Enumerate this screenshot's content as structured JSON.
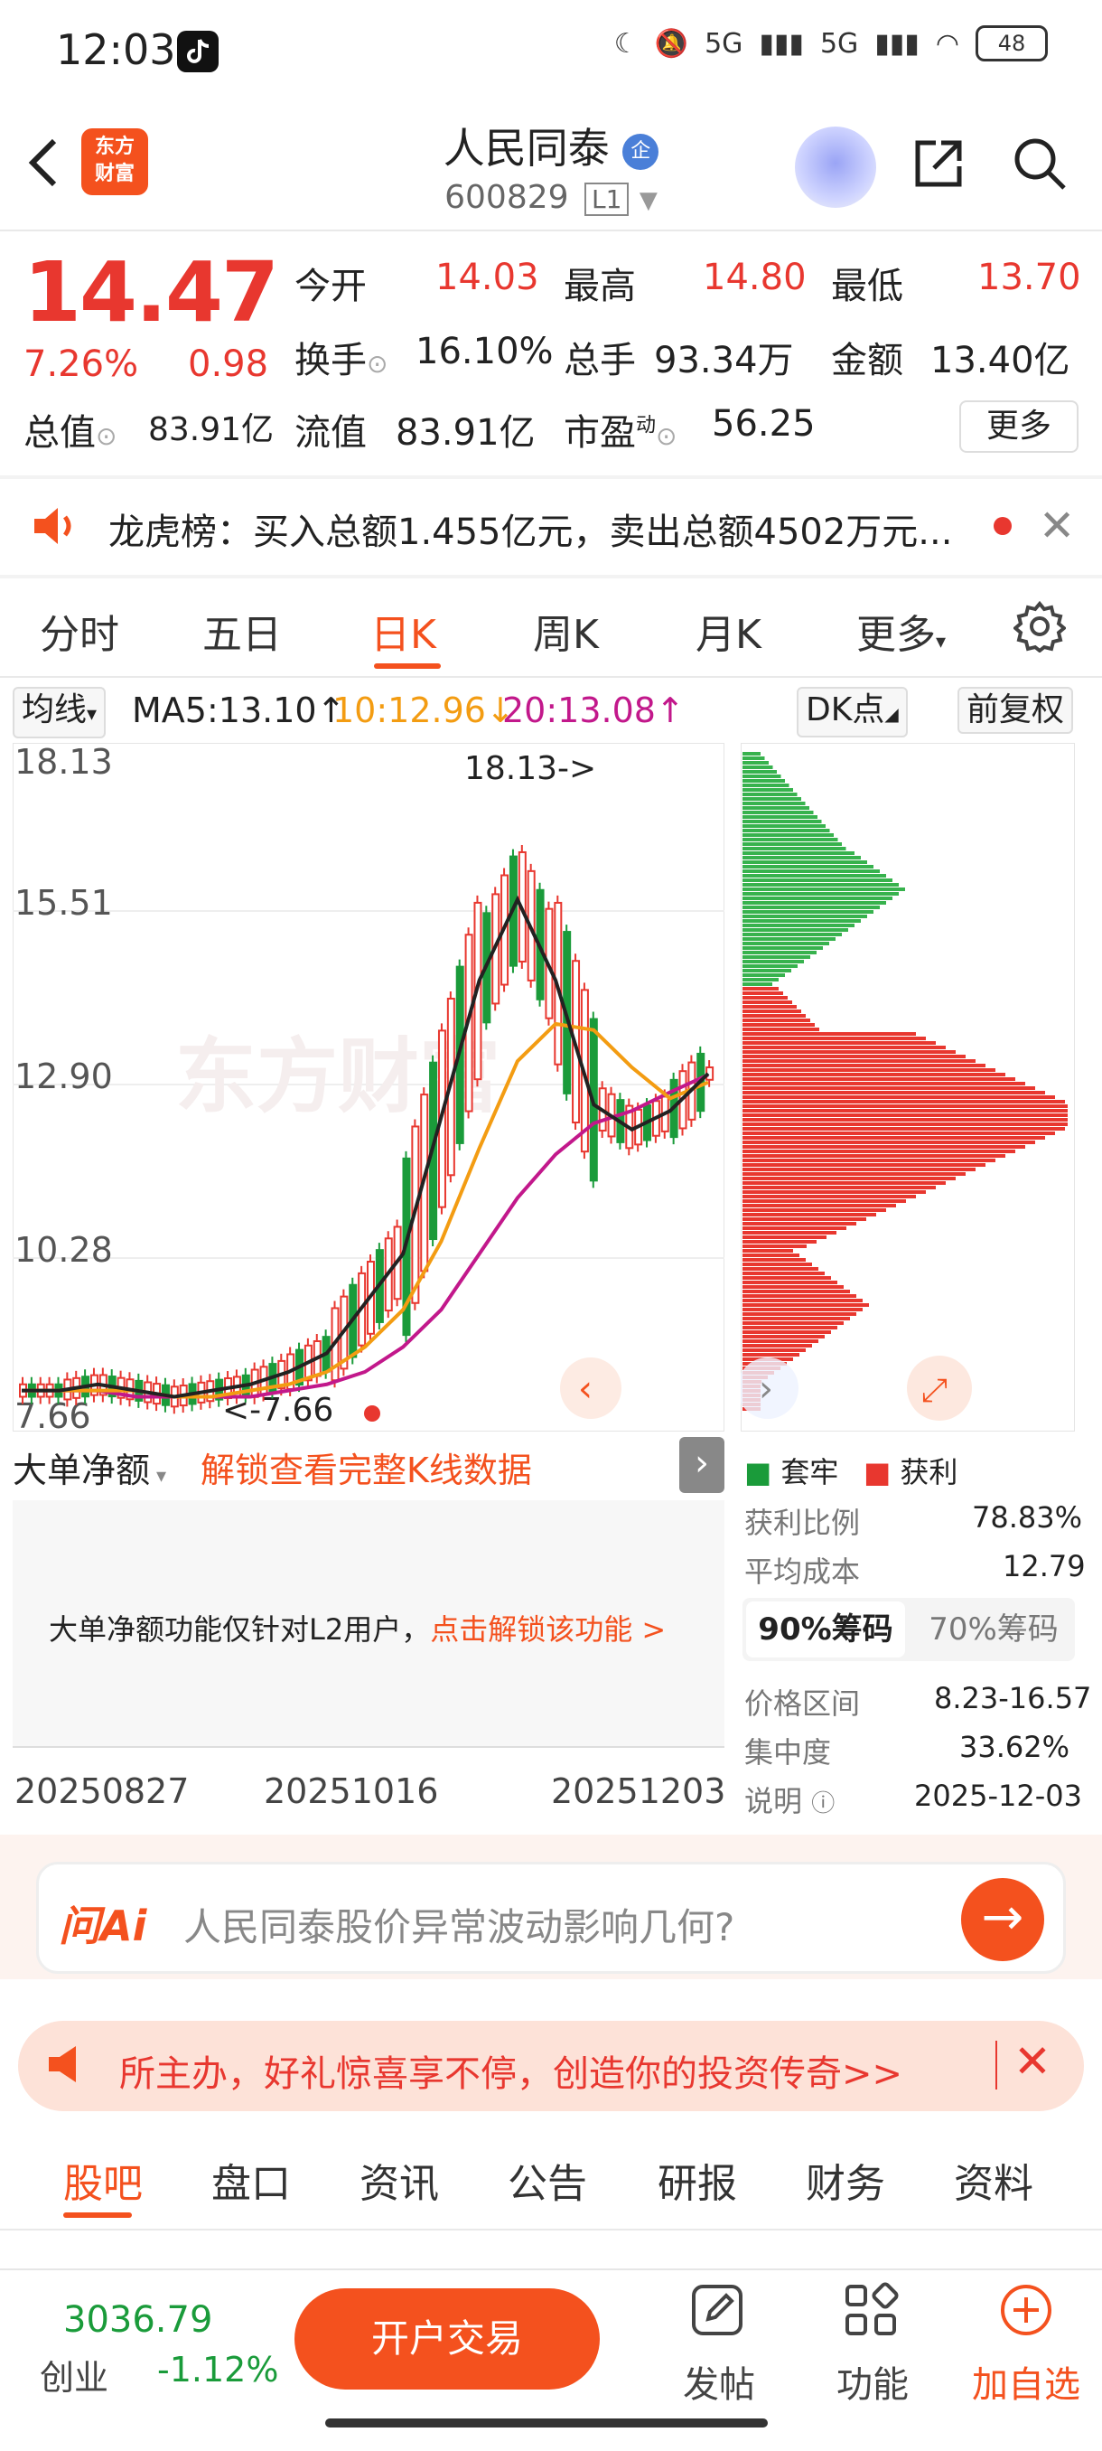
{
  "status": {
    "time": "12:03",
    "network": "5G",
    "network2": "5G",
    "battery": "48"
  },
  "header": {
    "logo_text_1": "东方",
    "logo_text_2": "财富",
    "stock_name": "人民同泰",
    "badge": "企",
    "stock_code": "600829",
    "level": "L1"
  },
  "quote": {
    "price": "14.47",
    "pct_change": "7.26%",
    "change": "0.98",
    "open_label": "今开",
    "open": "14.03",
    "high_label": "最高",
    "high": "14.80",
    "low_label": "最低",
    "low": "13.70",
    "turnover_label": "换手",
    "turnover": "16.10%",
    "volume_label": "总手",
    "volume": "93.34万",
    "amount_label": "金额",
    "amount": "13.40亿",
    "mcap_label": "总值",
    "mcap": "83.91亿",
    "float_label": "流值",
    "float_mcap": "83.91亿",
    "pe_label": "市盈",
    "pe_sup": "动",
    "pe": "56.25",
    "more": "更多"
  },
  "dragon_tiger": {
    "text": "龙虎榜：买入总额1.455亿元，卖出总额4502万元..."
  },
  "tabs": [
    {
      "label": "分时"
    },
    {
      "label": "五日"
    },
    {
      "label": "日K"
    },
    {
      "label": "周K"
    },
    {
      "label": "月K"
    },
    {
      "label": "更多"
    }
  ],
  "ma": {
    "selector": "均线",
    "ma5": "MA5:13.10",
    "ma10": "10:12.96",
    "ma20": "20:13.08",
    "dk": "DK点",
    "adjust": "前复权"
  },
  "colors": {
    "accent": "#f4511e",
    "up": "#e8372f",
    "down": "#1a9b3a",
    "ma5": "#222222",
    "ma10": "#f39c12",
    "ma20": "#c2188b"
  },
  "chart_data": {
    "type": "candlestick",
    "y_ticks": [
      "18.13",
      "15.51",
      "12.90",
      "10.28",
      "7.66"
    ],
    "ylim": [
      7.66,
      18.13
    ],
    "annotations": [
      "18.13->",
      "<-7.66"
    ],
    "x_ticks": [
      "20250827",
      "20251016",
      "20251203"
    ],
    "watermark": "东方财富",
    "ma5": [
      8.0,
      8.0,
      8.1,
      8.0,
      7.9,
      8.0,
      8.1,
      8.3,
      8.6,
      9.4,
      10.2,
      12.4,
      14.6,
      15.9,
      14.6,
      12.6,
      12.2,
      12.5,
      13.1
    ],
    "ma10": [
      8.0,
      8.0,
      8.0,
      8.0,
      7.9,
      7.9,
      8.0,
      8.1,
      8.3,
      8.7,
      9.3,
      10.4,
      11.9,
      13.3,
      13.9,
      13.8,
      13.2,
      12.7,
      12.96
    ],
    "ma20": [
      8.0,
      8.0,
      8.0,
      7.9,
      7.9,
      7.9,
      7.9,
      8.0,
      8.1,
      8.3,
      8.7,
      9.3,
      10.2,
      11.1,
      11.8,
      12.3,
      12.5,
      12.8,
      13.08
    ]
  },
  "indicator": {
    "selector": "大单净额",
    "unlock_link": "解锁查看完整K线数据",
    "notice": "大单净额功能仅针对L2用户，",
    "notice_link": "点击解锁该功能 >"
  },
  "chip_dist": {
    "legend_trapped": "套牢",
    "legend_profit": "获利",
    "profit_ratio_label": "获利比例",
    "profit_ratio": "78.83%",
    "avg_cost_label": "平均成本",
    "avg_cost": "12.79",
    "tab_90": "90%筹码",
    "tab_70": "70%筹码",
    "range_label": "价格区间",
    "range": "8.23-16.57",
    "concentration_label": "集中度",
    "concentration": "33.62%",
    "note_label": "说明",
    "date": "2025-12-03"
  },
  "ai": {
    "brand": "问Ai",
    "question": "人民同泰股价异常波动影响几何?"
  },
  "promo": {
    "text": "所主办，好礼惊喜享不停，创造你的投资传奇>>"
  },
  "bottom_tabs": [
    {
      "label": "股吧"
    },
    {
      "label": "盘口"
    },
    {
      "label": "资讯"
    },
    {
      "label": "公告"
    },
    {
      "label": "研报"
    },
    {
      "label": "财务"
    },
    {
      "label": "资料"
    }
  ],
  "footer": {
    "index_value": "3036.79",
    "index_name": "创业",
    "index_change": "-1.12%",
    "trade": "开户交易",
    "post": "发帖",
    "function": "功能",
    "watch": "加自选"
  }
}
